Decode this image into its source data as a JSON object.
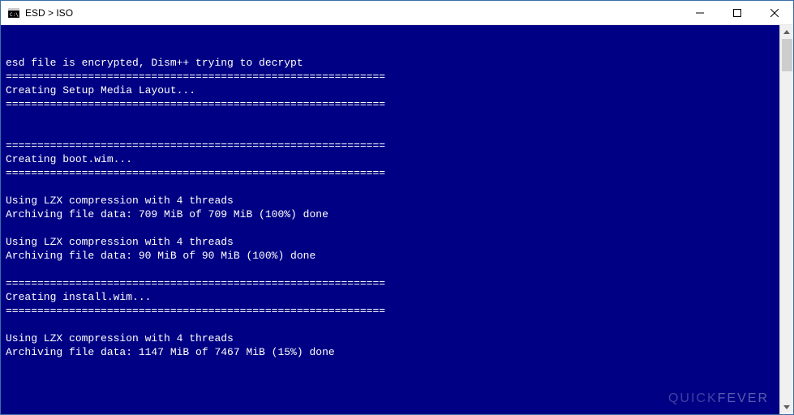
{
  "window": {
    "title": "ESD > ISO"
  },
  "console": {
    "lines": [
      "",
      "",
      "esd file is encrypted, Dism++ trying to decrypt",
      "============================================================",
      "Creating Setup Media Layout...",
      "============================================================",
      "",
      "",
      "============================================================",
      "Creating boot.wim...",
      "============================================================",
      "",
      "Using LZX compression with 4 threads",
      "Archiving file data: 709 MiB of 709 MiB (100%) done",
      "",
      "Using LZX compression with 4 threads",
      "Archiving file data: 90 MiB of 90 MiB (100%) done",
      "",
      "============================================================",
      "Creating install.wim...",
      "============================================================",
      "",
      "Using LZX compression with 4 threads",
      "Archiving file data: 1147 MiB of 7467 MiB (15%) done"
    ]
  },
  "watermark": {
    "part1": "QUICK",
    "part2": "FEVER"
  }
}
